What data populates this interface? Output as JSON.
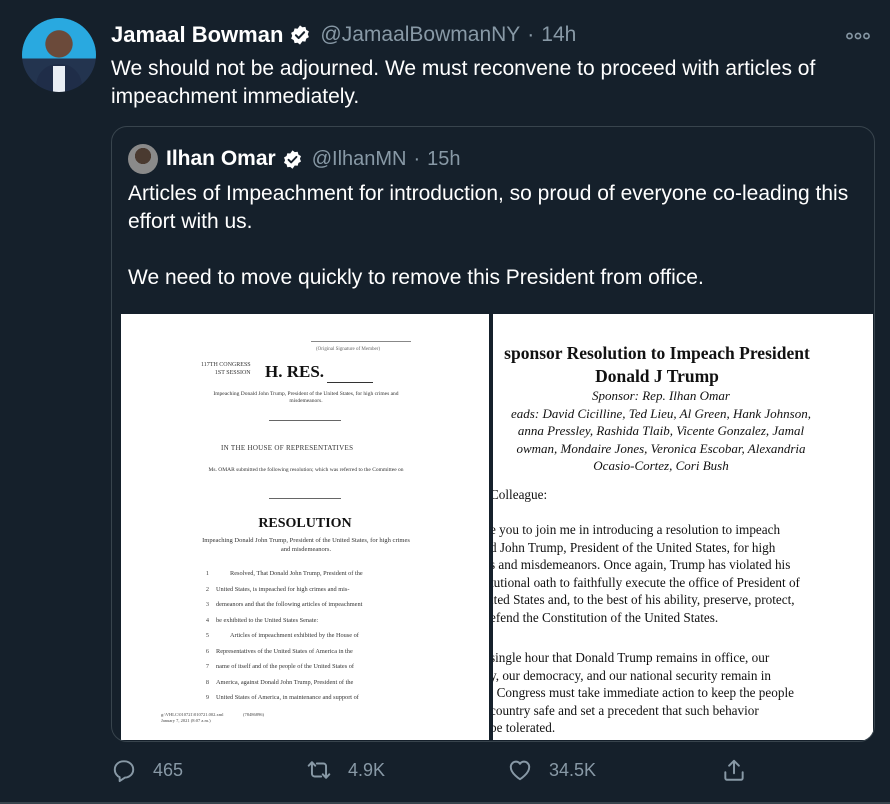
{
  "tweet": {
    "author_name": "Jamaal Bowman",
    "handle": "@JamaalBowmanNY",
    "separator": "·",
    "time": "14h",
    "text": "We should not be adjourned. We must reconvene to proceed with articles of impeachment immediately.",
    "more_icon": "more-horizontal-icon"
  },
  "quoted": {
    "author_name": "Ilhan Omar",
    "handle": "@IlhanMN",
    "separator": "·",
    "time": "15h",
    "paragraph1": "Articles of Impeachment for introduction, so proud of everyone co-leading this effort with us.",
    "paragraph2": "We need to move quickly to remove this President from office."
  },
  "doc_left": {
    "signature_caption": "(Original Signature of Member)",
    "congress_line1": "117TH CONGRESS",
    "congress_line2": "1ST SESSION",
    "hres": "H. RES.",
    "subtitle": "Impeaching Donald John Trump, President of the United States, for high crimes and misdemeanors.",
    "house": "IN THE HOUSE OF REPRESENTATIVES",
    "omar_line": "Ms. OMAR submitted the following resolution; which was referred to the Committee on",
    "resolution": "RESOLUTION",
    "resolution_sub": "Impeaching Donald John Trump, President of the United States, for high crimes and misdemeanors.",
    "lines": [
      {
        "n": "1",
        "t": "Resolved, That Donald John Trump, President of the"
      },
      {
        "n": "2",
        "t": "United States, is impeached for high crimes and mis-"
      },
      {
        "n": "3",
        "t": "demeanors and that the following articles of impeachment"
      },
      {
        "n": "4",
        "t": "be exhibited to the United States Senate:"
      },
      {
        "n": "5",
        "t": "Articles of impeachment exhibited by the House of"
      },
      {
        "n": "6",
        "t": "Representatives of the United States of America in the"
      },
      {
        "n": "7",
        "t": "name of itself and of the people of the United States of"
      },
      {
        "n": "8",
        "t": "America, against Donald John Trump, President of the"
      },
      {
        "n": "9",
        "t": "United States of America, in maintenance and support of"
      }
    ],
    "footer_path": "g:\\VHLC\\010721\\010721.002.xml",
    "footer_date": "January 7, 2021 (8:07 a.m.)",
    "footer_code": "(78486896)"
  },
  "doc_right": {
    "title_line1": "sponsor Resolution to Impeach President",
    "title_line2": "Donald J Trump",
    "names": [
      "Sponsor: Rep. Ilhan Omar",
      "eads: David Cicilline, Ted Lieu, Al Green, Hank Johnson,",
      "anna Pressley, Rashida Tlaib, Vicente Gonzalez, Jamal",
      "owman, Mondaire Jones, Veronica Escobar, Alexandria",
      "Ocasio-Cortez, Cori Bush"
    ],
    "greeting": "Colleague:",
    "body1": [
      "e you to join me in introducing a resolution to impeach",
      "d John Trump, President of the United States, for high",
      "s and misdemeanors. Once again, Trump has violated his",
      "tutional oath to faithfully execute the office of President of",
      "ited States and, to the best of his ability, preserve, protect,",
      "efend the Constitution of the United States."
    ],
    "body2": [
      "single hour that Donald Trump remains in office, our",
      "y, our democracy, and our national security remain in",
      ". Congress must take immediate action to keep the people",
      "country safe and set a precedent that such behavior",
      "be tolerated."
    ]
  },
  "actions": {
    "reply_count": "465",
    "retweet_count": "4.9K",
    "like_count": "34.5K"
  },
  "colors": {
    "background": "#15202b",
    "secondary_text": "#8899a6",
    "border": "#38444d"
  }
}
